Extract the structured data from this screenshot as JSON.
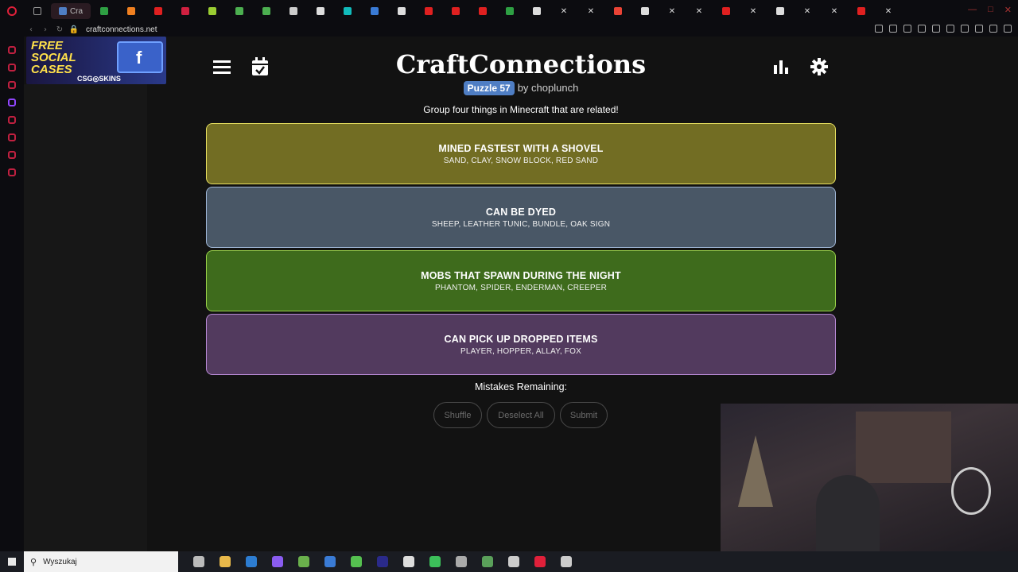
{
  "browser": {
    "url": "craftconnections.net",
    "active_tab_label": "Cra",
    "tabs": [
      {
        "icon": "tab-icon",
        "color": "#2ea043"
      },
      {
        "icon": "tab-icon",
        "color": "#f08020"
      },
      {
        "icon": "youtube-icon",
        "color": "#e02020"
      },
      {
        "icon": "tab-icon",
        "color": "#d02040"
      },
      {
        "icon": "tab-icon",
        "color": "#9acd32"
      },
      {
        "icon": "tab-icon",
        "color": "#4caf50"
      },
      {
        "icon": "tab-icon",
        "color": "#4caf50"
      },
      {
        "icon": "tab-icon",
        "color": "#cccccc"
      },
      {
        "icon": "tab-icon",
        "color": "#dddddd"
      },
      {
        "icon": "tab-icon",
        "color": "#1bb"
      },
      {
        "icon": "tab-icon",
        "color": "#3a7bd5"
      },
      {
        "icon": "tab-icon",
        "color": "#dddddd"
      },
      {
        "icon": "youtube-icon",
        "color": "#e02020"
      },
      {
        "icon": "youtube-icon",
        "color": "#e02020"
      },
      {
        "icon": "youtube-icon",
        "color": "#e02020"
      },
      {
        "icon": "tab-icon",
        "color": "#2ea043"
      },
      {
        "icon": "tiktok-icon",
        "color": "#dddddd"
      },
      {
        "icon": "x-icon",
        "color": "#dddddd"
      },
      {
        "icon": "x-icon",
        "color": "#dddddd"
      },
      {
        "icon": "google-icon",
        "color": "#ea4335"
      },
      {
        "icon": "wikipedia-icon",
        "color": "#dddddd"
      },
      {
        "icon": "x-icon",
        "color": "#dddddd"
      },
      {
        "icon": "x-icon",
        "color": "#dddddd"
      },
      {
        "icon": "youtube-icon",
        "color": "#e02020"
      },
      {
        "icon": "x-icon",
        "color": "#dddddd"
      },
      {
        "icon": "tiktok-icon",
        "color": "#dddddd"
      },
      {
        "icon": "x-icon",
        "color": "#dddddd"
      },
      {
        "icon": "x-icon",
        "color": "#dddddd"
      },
      {
        "icon": "youtube-icon",
        "color": "#e02020"
      },
      {
        "icon": "x-icon",
        "color": "#dddddd"
      }
    ]
  },
  "ad": {
    "title": "FREE SOCIAL CASES",
    "brand": "CSG◎SKINS"
  },
  "app": {
    "title": "CraftConnections",
    "puzzle_badge": "Puzzle 57",
    "byline": "by choplunch",
    "subtitle": "Group four things in Minecraft that are related!"
  },
  "groups": [
    {
      "title": "MINED FASTEST WITH A SHOVEL",
      "items": "SAND, CLAY, SNOW BLOCK, RED SAND",
      "color": "#726d23",
      "border": "#e8e060"
    },
    {
      "title": "CAN BE DYED",
      "items": "SHEEP, LEATHER TUNIC, BUNDLE, OAK SIGN",
      "color": "#495766",
      "border": "#9fb6d6"
    },
    {
      "title": "MOBS THAT SPAWN DURING THE NIGHT",
      "items": "PHANTOM, SPIDER, ENDERMAN, CREEPER",
      "color": "#3e6b1c",
      "border": "#9ad24a"
    },
    {
      "title": "CAN PICK UP DROPPED ITEMS",
      "items": "PLAYER, HOPPER, ALLAY, FOX",
      "color": "#523a5e",
      "border": "#b88ad6"
    }
  ],
  "mistakes_label": "Mistakes Remaining:",
  "controls": {
    "shuffle": "Shuffle",
    "deselect": "Deselect All",
    "submit": "Submit"
  },
  "taskbar": {
    "search_placeholder": "Wyszukaj",
    "icons": [
      "task-view-icon",
      "file-explorer-icon",
      "vscode-icon",
      "app-icon",
      "app-icon",
      "steam-icon",
      "app-icon",
      "premiere-icon",
      "obs-icon",
      "app-icon",
      "app-icon",
      "app-icon",
      "app-icon",
      "opera-icon",
      "obs-icon"
    ]
  }
}
